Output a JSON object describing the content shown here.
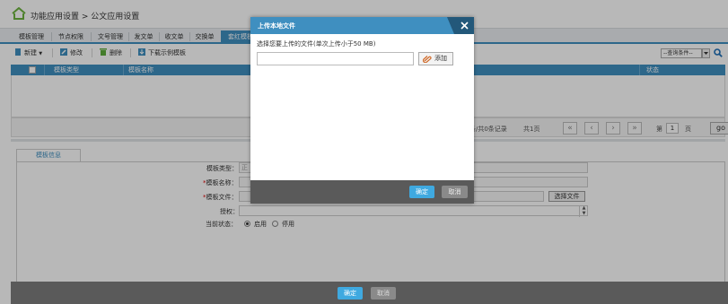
{
  "breadcrumb": "功能应用设置 > 公文应用设置",
  "tabs": [
    "模板管理",
    "节点权限",
    "文号管理",
    "发文单",
    "收文单",
    "交换单",
    "套红模板"
  ],
  "toolbar": {
    "new_label": "新建",
    "edit_label": "修改",
    "delete_label": "删除",
    "download_label": "下载示例模板",
    "query_select": "--查询条件--"
  },
  "grid": {
    "columns": [
      "模板类型",
      "模板名称",
      "状态"
    ]
  },
  "pager": {
    "records": "条/共0条记录",
    "pages": "共1页",
    "page_prefix": "第",
    "page_value": "1",
    "page_suffix": "页",
    "go_label": "go"
  },
  "form": {
    "tab_label": "模板信息",
    "type_label": "模板类型：",
    "type_value": "正",
    "name_label": "模板名称：",
    "file_label": "模板文件：",
    "file_button": "选择文件",
    "auth_label": "授权：",
    "status_label": "当前状态：",
    "status_enabled": "启用",
    "status_disabled": "停用",
    "status_selected": "启用"
  },
  "bottom": {
    "ok_label": "确定",
    "cancel_label": "取消"
  },
  "dialog": {
    "title": "上传本地文件",
    "prompt": "选择您要上传的文件(单次上传小于50 MB)",
    "add_label": "添加",
    "ok_label": "确定",
    "cancel_label": "取消"
  }
}
